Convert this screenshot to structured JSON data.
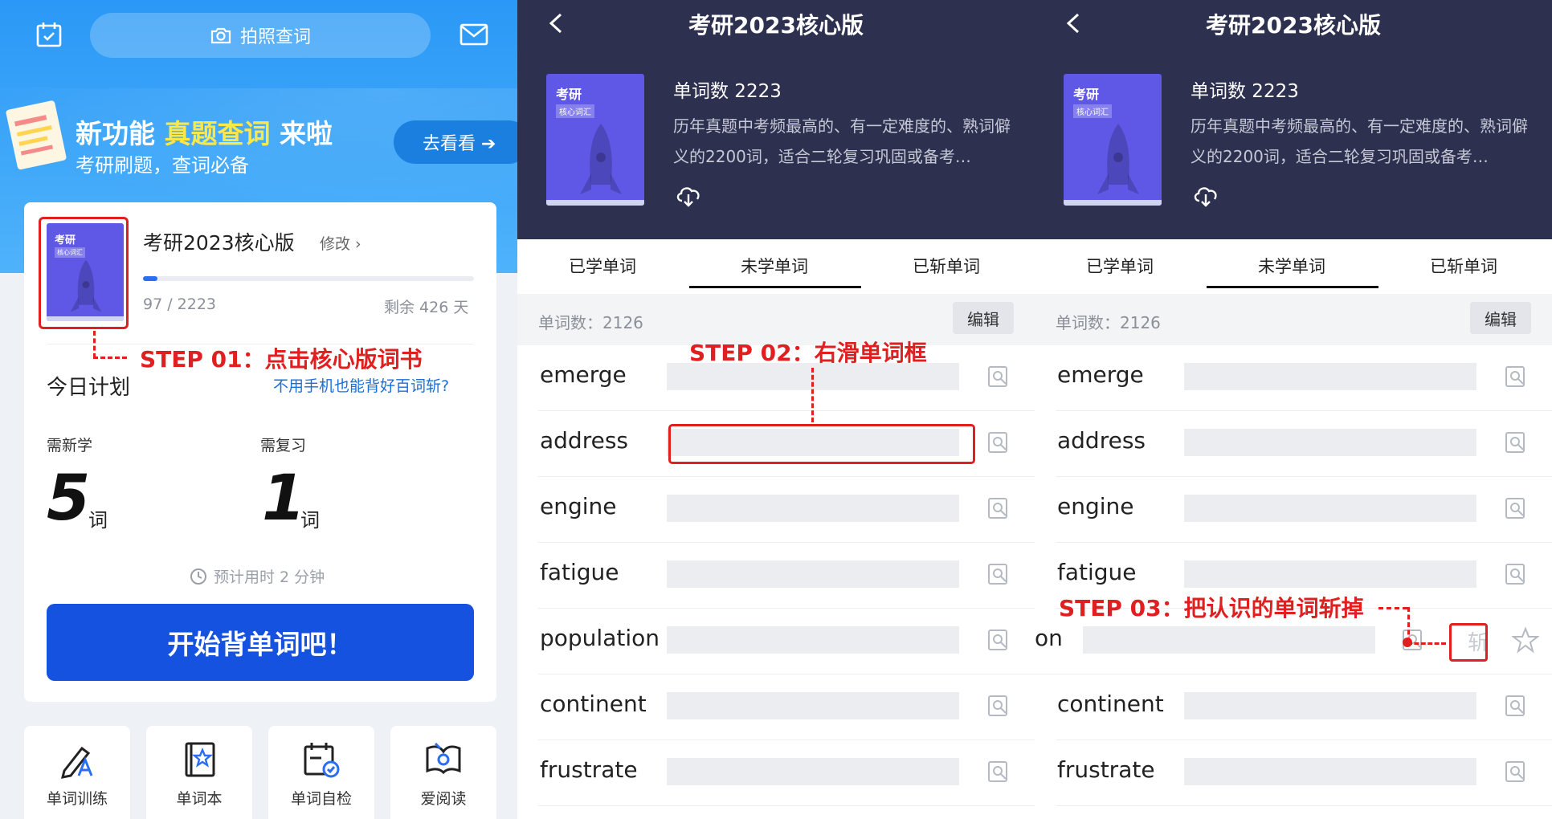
{
  "panel1": {
    "top": {
      "photo_search_label": "拍照查词",
      "icons": {
        "calendar": "calendar-check-icon",
        "camera": "camera-icon",
        "mail": "mail-icon"
      }
    },
    "promo": {
      "title_prefix": "新功能 ",
      "title_highlight": "真题查词",
      "title_suffix": " 来啦",
      "subtitle": "考研刷题，查词必备",
      "button_label": "去看看 ➔"
    },
    "book": {
      "cover_title": "考研",
      "cover_tag": "核心词汇",
      "title": "考研2023核心版",
      "edit_label": "修改 ›",
      "progress_text": "97 / 2223",
      "progress_fraction": 0.0436,
      "remaining": "剩余 426 天"
    },
    "step1": "STEP 01：点击核心版词书",
    "plan": {
      "title": "今日计划",
      "link": "不用手机也能背好百词斩?",
      "new_label": "需新学",
      "review_label": "需复习",
      "new_count": "5",
      "review_count": "1",
      "unit": "词",
      "eta": "预计用时 2 分钟",
      "start_button": "开始背单词吧！"
    },
    "tiles": [
      {
        "label": "单词训练",
        "icon": "pen-train-icon"
      },
      {
        "label": "单词本",
        "icon": "star-book-icon"
      },
      {
        "label": "单词自检",
        "icon": "calendar-check-icon"
      },
      {
        "label": "爱阅读",
        "icon": "open-book-icon"
      }
    ]
  },
  "wordbook": {
    "title": "考研2023核心版",
    "cover_title": "考研",
    "cover_tag": "核心词汇",
    "word_count_label": "单词数 2223",
    "description": "历年真题中考频最高的、有一定难度的、熟词僻义的2200词，适合二轮复习巩固或备考…",
    "tabs": [
      "已学单词",
      "未学单词",
      "已斩单词"
    ],
    "active_tab": 1,
    "list_count": "单词数：2126",
    "edit_label": "编辑",
    "words": [
      "emerge",
      "address",
      "engine",
      "fatigue",
      "population",
      "continent",
      "frustrate"
    ]
  },
  "panel3": {
    "slid_word_visible": "on",
    "zhan_label": "斩"
  },
  "step2": "STEP 02：右滑单词框",
  "step3": "STEP 03：把认识的单词斩掉",
  "colors": {
    "accent_blue": "#1552e0",
    "header_dark": "#2e3050",
    "book_purple": "#5f57e6",
    "annotation_red": "#e02020",
    "promo_highlight": "#fde84a"
  }
}
